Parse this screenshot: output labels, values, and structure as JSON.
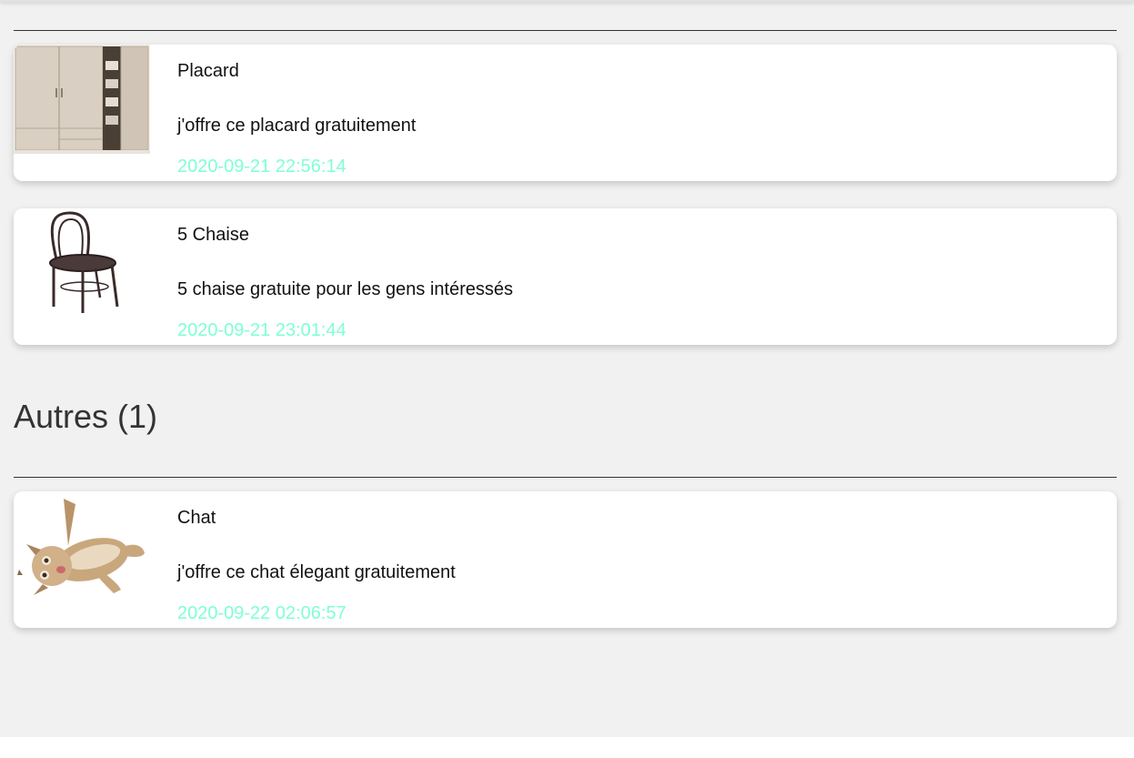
{
  "colors": {
    "background": "#f1f1f1",
    "card": "#ffffff",
    "date": "#7fffd4",
    "divider": "#333333"
  },
  "listings_top": [
    {
      "title": "Placard",
      "description": "j'offre ce placard gratuitement",
      "date": "2020-09-21 22:56:14",
      "image_icon": "wardrobe-photo"
    },
    {
      "title": "5 Chaise",
      "description": "5 chaise gratuite pour les gens intéressés",
      "date": "2020-09-21 23:01:44",
      "image_icon": "chair-photo"
    }
  ],
  "section_other": {
    "heading": "Autres (1)"
  },
  "listings_other": [
    {
      "title": "Chat",
      "description": "j'offre ce chat élegant gratuitement",
      "date": "2020-09-22 02:06:57",
      "image_icon": "cat-photo"
    }
  ]
}
